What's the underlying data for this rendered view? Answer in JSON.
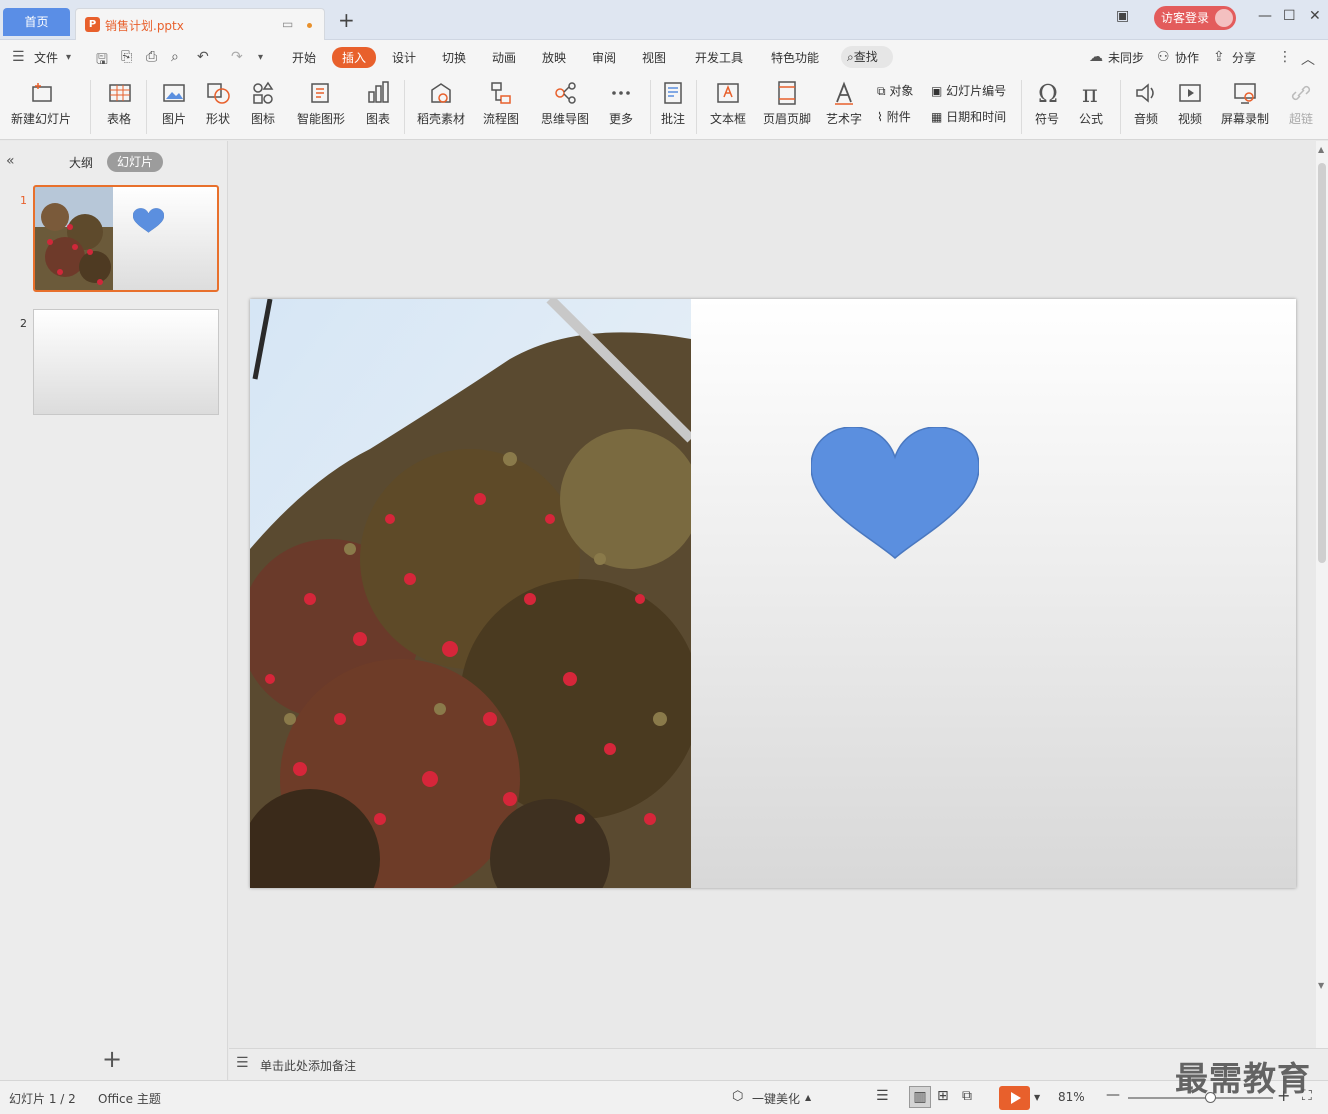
{
  "tabs": {
    "home": "首页",
    "doc_name": "销售计划.pptx"
  },
  "account": {
    "login": "访客登录"
  },
  "menu": {
    "file": "文件",
    "items": [
      "开始",
      "插入",
      "设计",
      "切换",
      "动画",
      "放映",
      "审阅",
      "视图",
      "开发工具",
      "特色功能"
    ],
    "active": "插入",
    "search": "查找",
    "sync": "未同步",
    "collab": "协作",
    "share": "分享"
  },
  "ribbon": {
    "new_slide": "新建幻灯片",
    "table": "表格",
    "picture": "图片",
    "shape": "形状",
    "icon": "图标",
    "smart_shape": "智能图形",
    "chart": "图表",
    "daoke": "稻壳素材",
    "flowchart": "流程图",
    "mindmap": "思维导图",
    "more": "更多",
    "comment": "批注",
    "textbox": "文本框",
    "header_footer": "页眉页脚",
    "wordart": "艺术字",
    "object": "对象",
    "attachment": "附件",
    "slide_number": "幻灯片编号",
    "datetime": "日期和时间",
    "symbol": "符号",
    "formula": "公式",
    "audio": "音频",
    "video": "视频",
    "screen_record": "屏幕录制",
    "hyperlink": "超链"
  },
  "panel": {
    "outline_tab": "大纲",
    "slides_tab": "幻灯片",
    "slide_numbers": [
      "1",
      "2"
    ]
  },
  "notes_placeholder": "单击此处添加备注",
  "status": {
    "slide_info": "幻灯片 1 / 2",
    "theme": "Office 主题",
    "beautify": "一键美化",
    "zoom": "81%"
  },
  "colors": {
    "accent": "#e8602c",
    "heart": "#5b8fdf",
    "home_tab": "#5a8ee6"
  },
  "watermark": "最需教育"
}
